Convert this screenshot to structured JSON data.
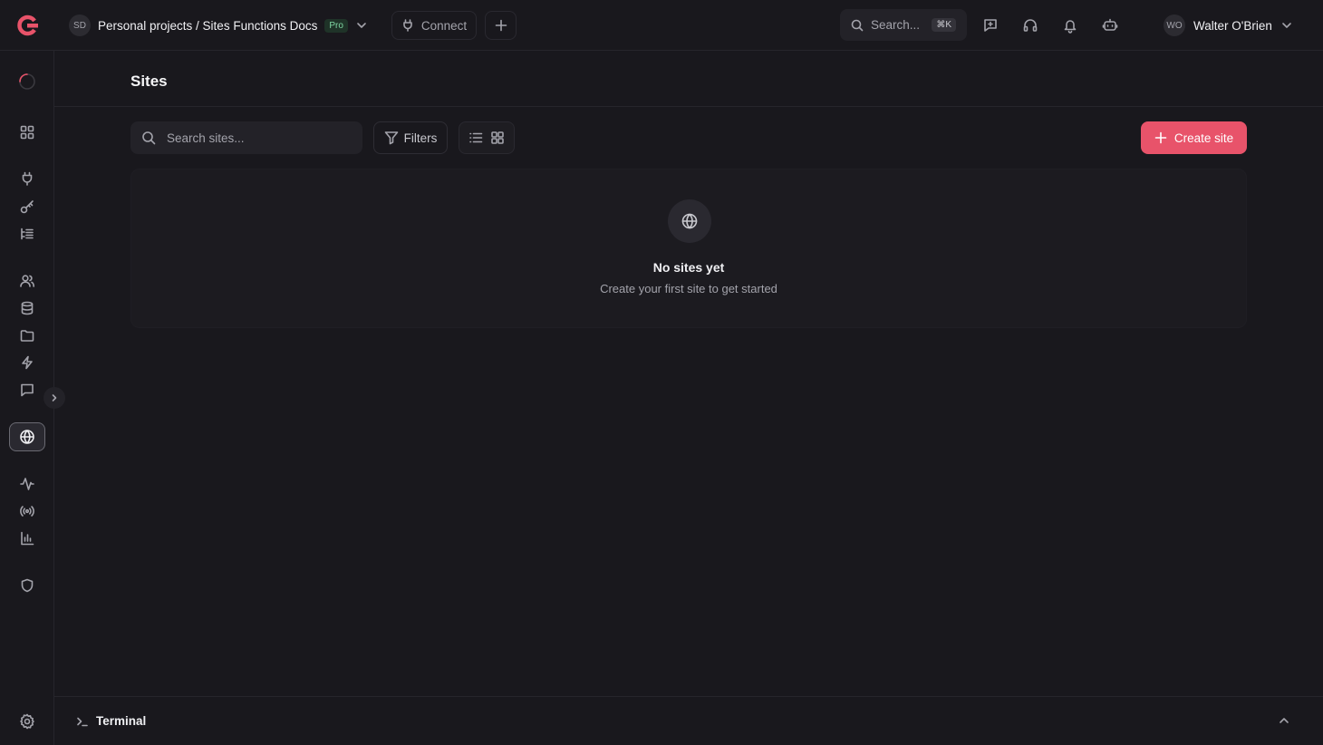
{
  "topbar": {
    "project_initials": "SD",
    "project_path": "Personal projects / Sites Functions Docs",
    "plan_badge": "Pro",
    "connect_label": "Connect",
    "search_placeholder": "Search...",
    "search_shortcut": "⌘K",
    "user_initials": "WO",
    "user_name": "Walter O'Brien"
  },
  "sidebar": {
    "icons": [
      "overview-icon",
      "plug-icon",
      "key-icon",
      "list-icon",
      "users-icon",
      "database-icon",
      "folder-icon",
      "bolt-icon",
      "messaging-icon",
      "globe-icon",
      "activity-icon",
      "broadcast-icon",
      "bar-chart-icon",
      "shield-icon",
      "settings-icon"
    ],
    "active": "sites"
  },
  "main": {
    "page_title": "Sites",
    "search_placeholder": "Search sites...",
    "filters_label": "Filters",
    "create_label": "Create site",
    "empty_title": "No sites yet",
    "empty_subtitle": "Create your first site to get started"
  },
  "terminal": {
    "label": "Terminal"
  },
  "colors": {
    "accent": "#e8536a",
    "background": "#19181d",
    "badge_green": "#7fd6a3"
  }
}
